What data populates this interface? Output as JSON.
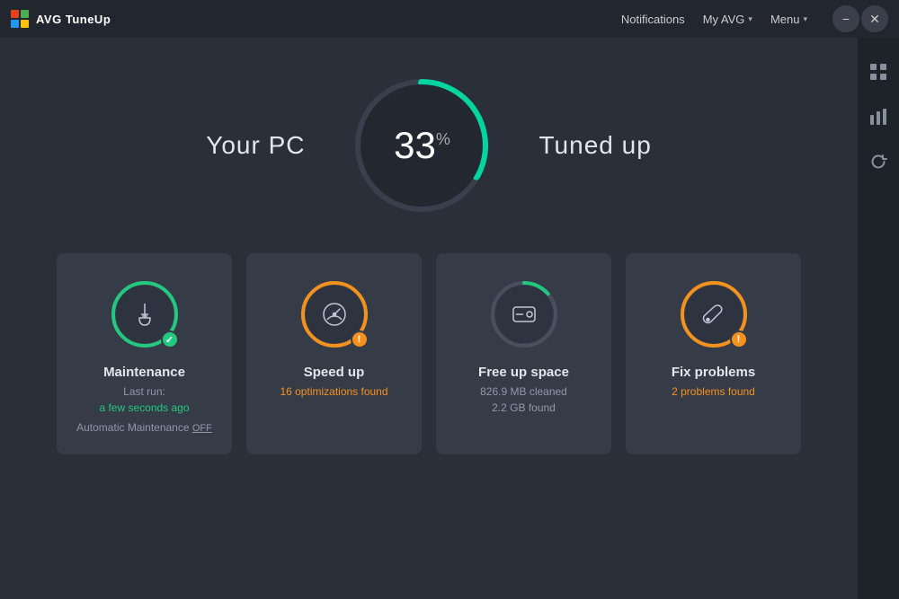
{
  "app": {
    "logo_label": "AVG",
    "title": "TuneUp"
  },
  "titlebar": {
    "notifications_label": "Notifications",
    "my_avg_label": "My AVG",
    "menu_label": "Menu",
    "minimize_label": "−",
    "close_label": "✕"
  },
  "gauge": {
    "left_label": "Your PC",
    "right_label": "Tuned up",
    "percent": "33",
    "percent_sign": "%",
    "fill_degrees": 33
  },
  "cards": [
    {
      "id": "maintenance",
      "title": "Maintenance",
      "subtitle_line1": "Last run:",
      "subtitle_line2": "a few seconds ago",
      "subtitle_line3": "Automatic Maintenance",
      "link_text": "OFF",
      "status": "ok",
      "ring_color": "green"
    },
    {
      "id": "speed-up",
      "title": "Speed up",
      "subtitle_line1": "16 optimizations found",
      "status": "warning",
      "ring_color": "orange"
    },
    {
      "id": "free-up-space",
      "title": "Free up space",
      "subtitle_line1": "826.9 MB cleaned",
      "subtitle_line2": "2.2 GB found",
      "status": "neutral",
      "ring_color": "dark"
    },
    {
      "id": "fix-problems",
      "title": "Fix problems",
      "subtitle_line1": "2 problems found",
      "status": "warning",
      "ring_color": "orange"
    }
  ],
  "sidebar": {
    "icons": [
      "apps",
      "chart",
      "refresh"
    ]
  }
}
